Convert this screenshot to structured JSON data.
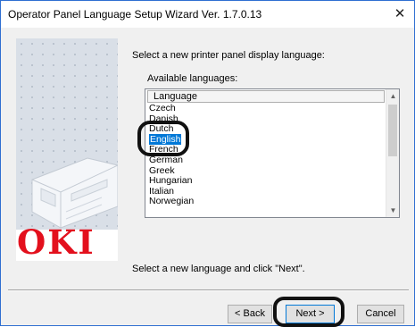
{
  "window": {
    "title": "Operator Panel Language Setup Wizard Ver. 1.7.0.13",
    "close_glyph": "✕"
  },
  "sidebar": {
    "logo_text": "OKI",
    "logo_color": "#e3101d"
  },
  "main": {
    "instruction": "Select a new printer panel display language:",
    "available_label": "Available languages:",
    "listbox": {
      "header": "Language",
      "items": [
        "Czech",
        "Danish",
        "Dutch",
        "English",
        "French",
        "German",
        "Greek",
        "Hungarian",
        "Italian",
        "Norwegian"
      ],
      "selected": "English"
    },
    "footer_instruction": "Select a new language and click \"Next\"."
  },
  "buttons": {
    "back": "< Back",
    "next": "Next >",
    "cancel": "Cancel"
  },
  "colors": {
    "selection": "#0078d7",
    "highlight_ring": "#111111"
  }
}
